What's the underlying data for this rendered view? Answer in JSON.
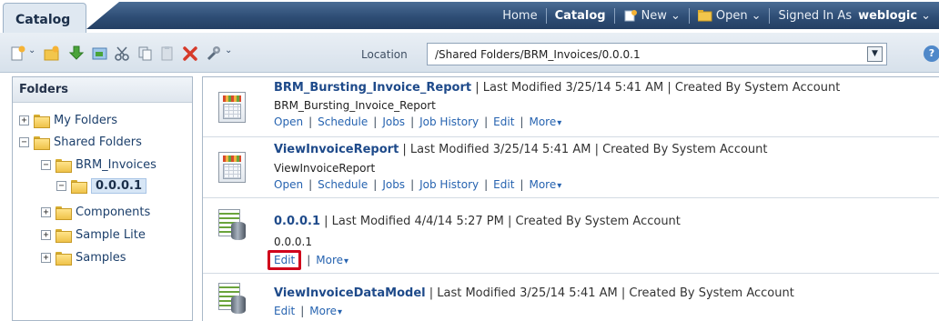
{
  "header": {
    "tab_label": "Catalog",
    "nav": {
      "home": "Home",
      "catalog": "Catalog",
      "new": "New",
      "open": "Open",
      "signed_in_prefix": "Signed In As",
      "user": "weblogic"
    }
  },
  "toolbar": {
    "location_label": "Location",
    "location_value": "/Shared Folders/BRM_Invoices/0.0.0.1",
    "help_glyph": "?"
  },
  "folders": {
    "title": "Folders",
    "tree": [
      {
        "label": "My Folders",
        "toggle": "+"
      },
      {
        "label": "Shared Folders",
        "toggle": "−"
      },
      {
        "label": "BRM_Invoices",
        "toggle": "−"
      },
      {
        "label": "0.0.0.1",
        "toggle": "−",
        "selected": true
      },
      {
        "label": "Components",
        "toggle": "+"
      },
      {
        "label": "Sample Lite",
        "toggle": "+"
      },
      {
        "label": "Samples",
        "toggle": "+"
      }
    ]
  },
  "items": [
    {
      "name": "BRM_Bursting_Invoice_Report",
      "meta": "| Last Modified 3/25/14 5:41 AM | Created By System Account",
      "description": "BRM_Bursting_Invoice_Report",
      "icon": "report-icon",
      "links": [
        "Open",
        "Schedule",
        "Jobs",
        "Job History",
        "Edit",
        "More"
      ]
    },
    {
      "name": "ViewInvoiceReport",
      "meta": "| Last Modified 3/25/14 5:41 AM | Created By System Account",
      "description": "ViewInvoiceReport",
      "icon": "report-icon",
      "links": [
        "Open",
        "Schedule",
        "Jobs",
        "Job History",
        "Edit",
        "More"
      ]
    },
    {
      "name": "0.0.0.1",
      "meta": "| Last Modified 4/4/14 5:27 PM | Created By System Account",
      "description": "0.0.0.1",
      "icon": "data-model-icon",
      "links": [
        "Edit",
        "More"
      ]
    },
    {
      "name": "ViewInvoiceDataModel",
      "meta": "| Last Modified 3/25/14 5:41 AM | Created By System Account",
      "description": "",
      "icon": "data-model-icon",
      "links": [
        "Edit",
        "More"
      ]
    }
  ],
  "colors": {
    "nav_bar": "#2e4d75",
    "link": "#2663b0",
    "highlight_border": "#d0021b"
  }
}
